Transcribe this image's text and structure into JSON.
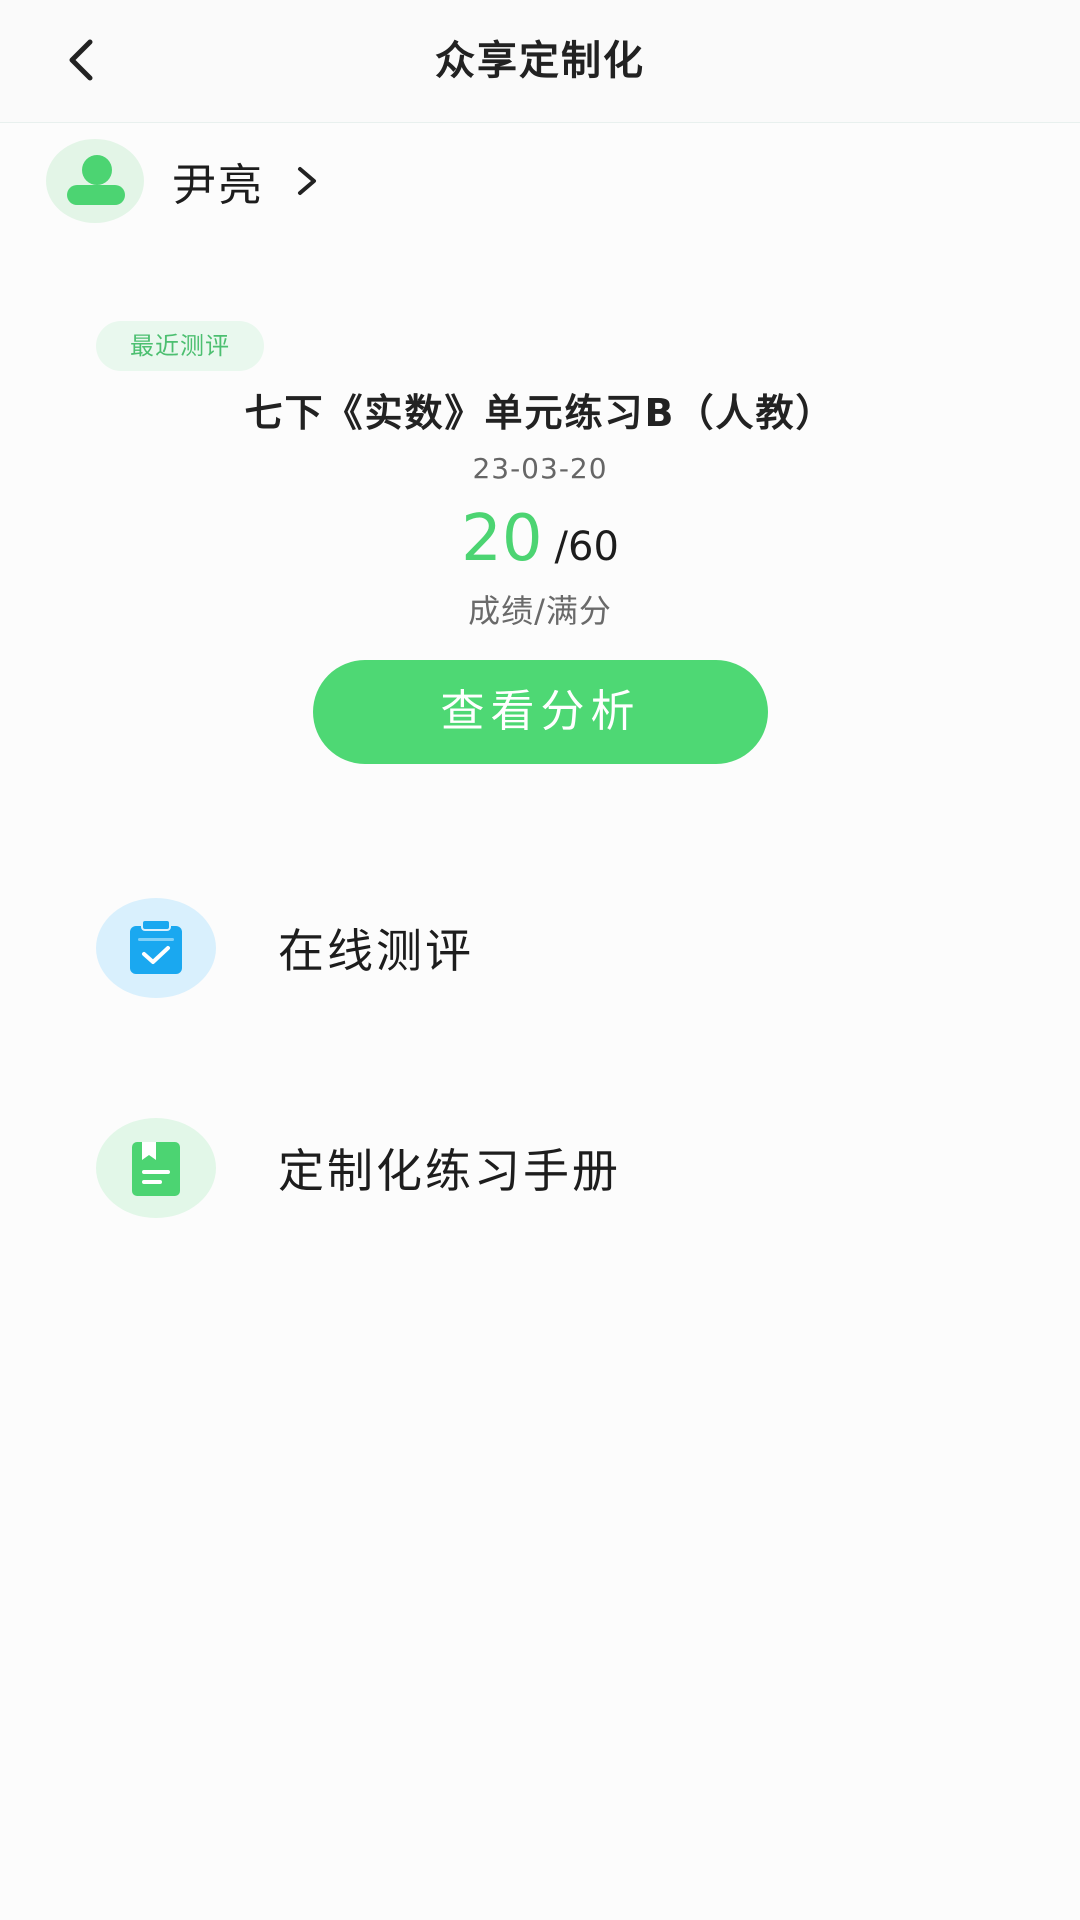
{
  "header": {
    "title": "众享定制化",
    "back_icon": "chevron-left-icon"
  },
  "user": {
    "name": "尹亮",
    "avatar_icon": "user-icon",
    "chevron_icon": "chevron-right-icon"
  },
  "recent": {
    "badge": "最近测评",
    "title": "七下《实数》单元练习B（人教）",
    "date": "23-03-20",
    "score": "20",
    "total": "/60",
    "caption": "成绩/满分",
    "analyze_label": "查看分析"
  },
  "menu": [
    {
      "label": "在线测评",
      "icon": "clipboard-check-icon",
      "color": "#1aa8f0"
    },
    {
      "label": "定制化练习手册",
      "icon": "bookmark-book-icon",
      "color": "#4cd472"
    }
  ],
  "colors": {
    "accent": "#4ed874",
    "badge_bg": "#e9f8ee",
    "blue": "#1aa8f0"
  }
}
